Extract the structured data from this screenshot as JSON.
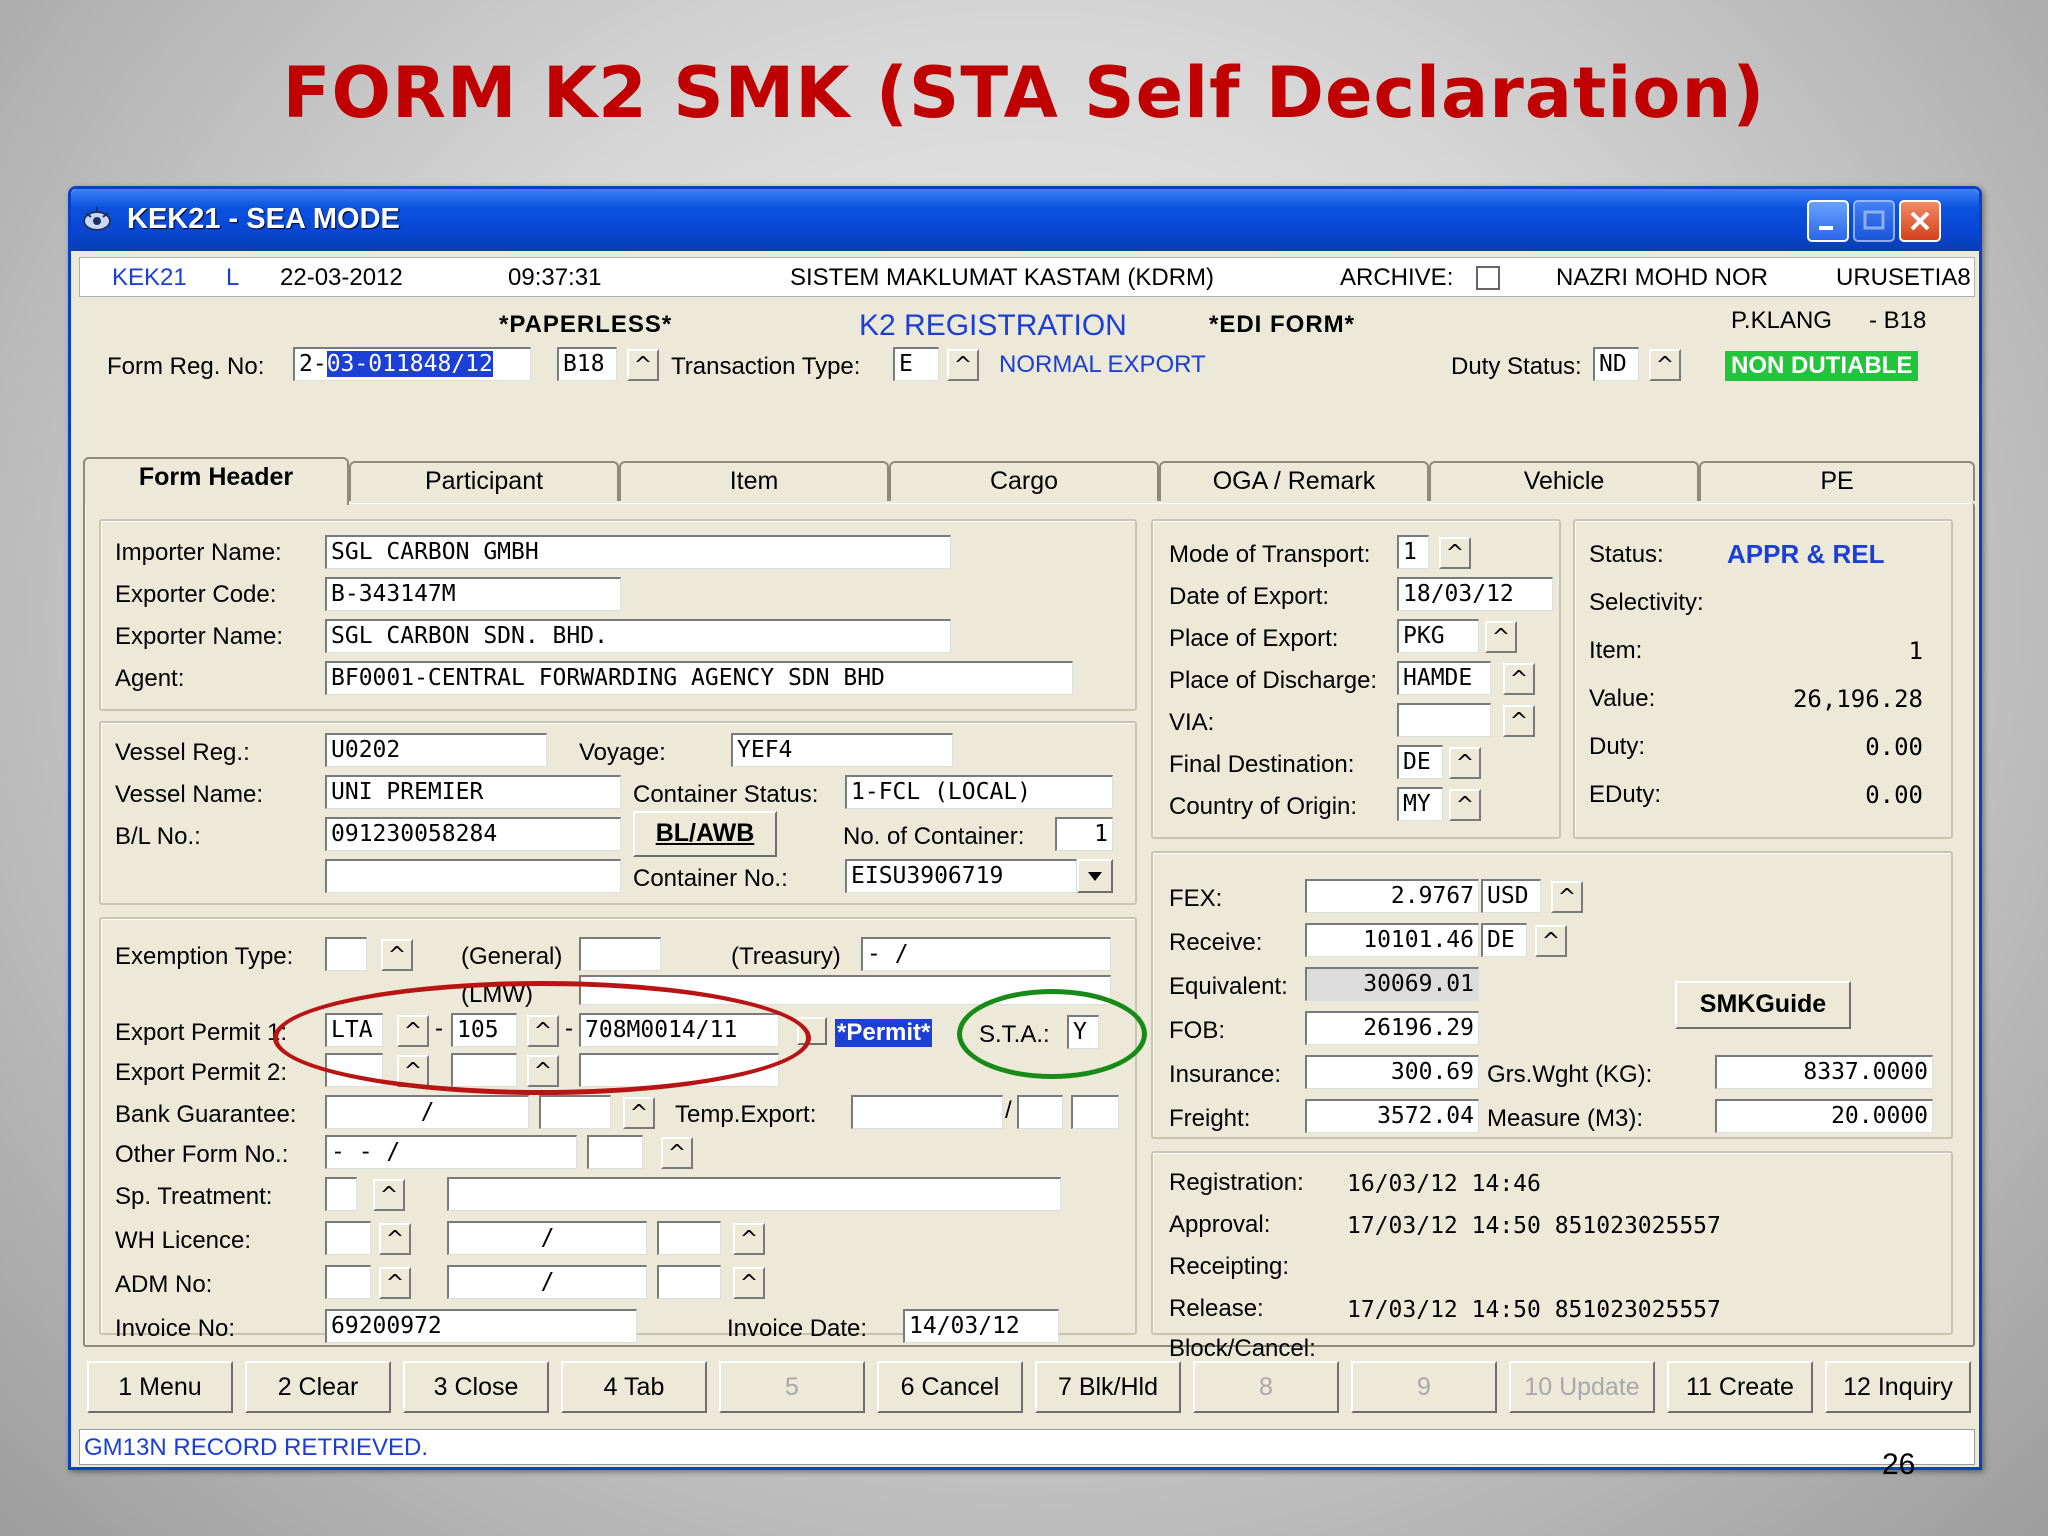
{
  "slide": {
    "title": "FORM K2 SMK (STA Self Declaration)",
    "page_number": "26"
  },
  "window": {
    "title": "KEK21 - SEA MODE"
  },
  "infobar": {
    "screen_code": "KEK21",
    "mode": "L",
    "date": "22-03-2012",
    "time": "09:37:31",
    "system": "SISTEM MAKLUMAT KASTAM (KDRM)",
    "archive_label": "ARCHIVE:",
    "user": "NAZRI MOHD NOR",
    "office": "URUSETIA8"
  },
  "header": {
    "paperless": "*PAPERLESS*",
    "registration": "K2 REGISTRATION",
    "edi_form": "*EDI FORM*",
    "station": "P.KLANG",
    "station_code": "- B18",
    "form_reg_label": "Form Reg. No:",
    "form_reg_prefix": "2-",
    "form_reg_value": "03-011848/12",
    "form_reg_station": "B18",
    "transaction_type_label": "Transaction Type:",
    "transaction_type_value": "E",
    "transaction_type_desc": "NORMAL EXPORT",
    "duty_status_label": "Duty Status:",
    "duty_status_value": "ND",
    "duty_status_desc": "NON DUTIABLE"
  },
  "tabs": [
    {
      "label": "Form Header"
    },
    {
      "label": "Participant"
    },
    {
      "label": "Item"
    },
    {
      "label": "Cargo"
    },
    {
      "label": "OGA / Remark"
    },
    {
      "label": "Vehicle"
    },
    {
      "label": "PE"
    }
  ],
  "parties": {
    "importer_name_label": "Importer Name:",
    "importer_name": "SGL CARBON GMBH",
    "exporter_code_label": "Exporter Code:",
    "exporter_code": "B-343147M",
    "exporter_name_label": "Exporter Name:",
    "exporter_name": "SGL CARBON SDN. BHD.",
    "agent_label": "Agent:",
    "agent": "BF0001-CENTRAL FORWARDING AGENCY SDN BHD"
  },
  "vessel": {
    "vessel_reg_label": "Vessel Reg.:",
    "vessel_reg": "U0202",
    "voyage_label": "Voyage:",
    "voyage": "YEF4",
    "vessel_name_label": "Vessel Name:",
    "vessel_name": "UNI PREMIER",
    "container_status_label": "Container Status:",
    "container_status": "1-FCL (LOCAL)",
    "bl_label": "B/L No.:",
    "bl_no": "091230058284",
    "bl_button": "BL/AWB",
    "no_container_label": "No. of Container:",
    "no_container": "1",
    "container_no_label": "Container No.:",
    "container_no": "EISU3906719"
  },
  "permits": {
    "exemption_label": "Exemption Type:",
    "general_label": "(General)",
    "treasury_label": "(Treasury)",
    "treasury_value": "-          /",
    "lmw_label": "(LMW)",
    "export_permit1_label": "Export Permit 1:",
    "export_permit1_a": "LTA",
    "export_permit1_b": "105",
    "export_permit1_c": "708M0014/11",
    "permit_tag": "*Permit*",
    "sta_label": "S.T.A.:",
    "sta_value": "Y",
    "export_permit2_label": "Export Permit 2:",
    "bank_guarantee_label": "Bank Guarantee:",
    "bank_guarantee_value": "/",
    "temp_export_label": "Temp.Export:",
    "other_form_label": "Other Form No.:",
    "other_form_value": "-   -         /",
    "sp_treatment_label": "Sp. Treatment:",
    "wh_licence_label": "WH Licence:",
    "adm_no_label": "ADM No:",
    "invoice_no_label": "Invoice No:",
    "invoice_no": "69200972",
    "invoice_date_label": "Invoice Date:",
    "invoice_date": "14/03/12"
  },
  "transport": {
    "mode_label": "Mode of Transport:",
    "mode": "1",
    "date_export_label": "Date of Export:",
    "date_export": "18/03/12",
    "place_export_label": "Place of Export:",
    "place_export": "PKG",
    "place_discharge_label": "Place of Discharge:",
    "place_discharge": "HAMDE",
    "via_label": "VIA:",
    "final_dest_label": "Final Destination:",
    "final_dest": "DE",
    "origin_label": "Country of Origin:",
    "origin": "MY"
  },
  "status": {
    "status_label": "Status:",
    "status_value": "APPR & REL",
    "selectivity_label": "Selectivity:",
    "item_label": "Item:",
    "item_value": "1",
    "value_label": "Value:",
    "value_value": "26,196.28",
    "duty_label": "Duty:",
    "duty_value": "0.00",
    "eduty_label": "EDuty:",
    "eduty_value": "0.00"
  },
  "finance": {
    "fex_label": "FEX:",
    "fex": "2.9767",
    "fex_currency": "USD",
    "receive_label": "Receive:",
    "receive": "10101.46",
    "receive_code": "DE",
    "equivalent_label": "Equivalent:",
    "equivalent": "30069.01",
    "smk_button": "SMKGuide",
    "fob_label": "FOB:",
    "fob": "26196.29",
    "insurance_label": "Insurance:",
    "insurance": "300.69",
    "grs_wght_label": "Grs.Wght (KG):",
    "grs_wght": "8337.0000",
    "freight_label": "Freight:",
    "freight": "3572.04",
    "measure_label": "Measure (M3):",
    "measure": "20.0000"
  },
  "history": {
    "registration_label": "Registration:",
    "registration": "16/03/12 14:46",
    "approval_label": "Approval:",
    "approval": "17/03/12 14:50 851023025557",
    "receipting_label": "Receipting:",
    "release_label": "Release:",
    "release": "17/03/12 14:50 851023025557",
    "block_label": "Block/Cancel:"
  },
  "function_keys": [
    {
      "label": "1 Menu",
      "enabled": true
    },
    {
      "label": "2 Clear",
      "enabled": true
    },
    {
      "label": "3 Close",
      "enabled": true
    },
    {
      "label": "4 Tab",
      "enabled": true
    },
    {
      "label": "5",
      "enabled": false
    },
    {
      "label": "6 Cancel",
      "enabled": true
    },
    {
      "label": "7 Blk/Hld",
      "enabled": true
    },
    {
      "label": "8",
      "enabled": false
    },
    {
      "label": "9",
      "enabled": false
    },
    {
      "label": "10 Update",
      "enabled": false
    },
    {
      "label": "11 Create",
      "enabled": true
    },
    {
      "label": "12 Inquiry",
      "enabled": true
    }
  ],
  "status_message": "GM13N  RECORD RETRIEVED.",
  "colors": {
    "title_red": "#c00000",
    "xp_blue": "#0846d3",
    "badge_green": "#22c43a",
    "circle_red": "#b81414",
    "circle_green": "#178a17"
  }
}
